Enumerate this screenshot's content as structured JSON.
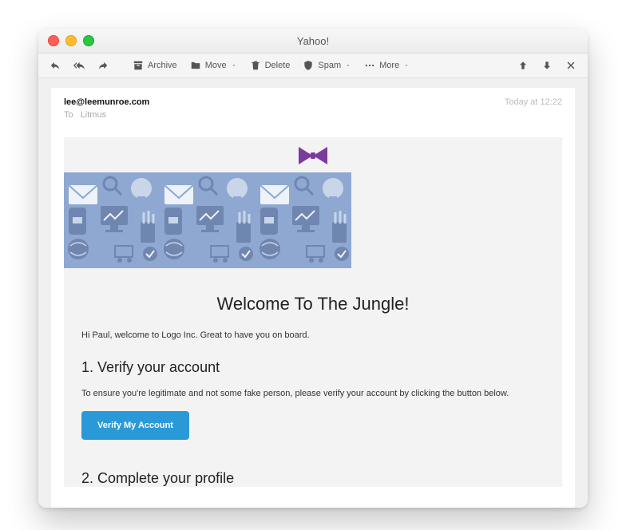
{
  "window": {
    "title": "Yahoo!"
  },
  "toolbar": {
    "archive": "Archive",
    "move": "Move",
    "delete": "Delete",
    "spam": "Spam",
    "more": "More"
  },
  "meta": {
    "from": "lee@leemunroe.com",
    "to_label": "To",
    "to_name": "Litmus",
    "time": "Today at 12:22"
  },
  "email": {
    "heading": "Welcome To The Jungle!",
    "intro": "Hi Paul, welcome to Logo Inc. Great to have you on board.",
    "step1_title": "1. Verify your account",
    "step1_body": "To ensure you're legitimate and not some fake person, please verify your account by clicking the button below.",
    "cta": "Verify My Account",
    "step2_title": "2. Complete your profile"
  },
  "colors": {
    "accent": "#2a99d8",
    "logo": "#7c3a9d",
    "hero_bg": "#8ea8d1",
    "hero_fg": "#c9d6ea"
  }
}
